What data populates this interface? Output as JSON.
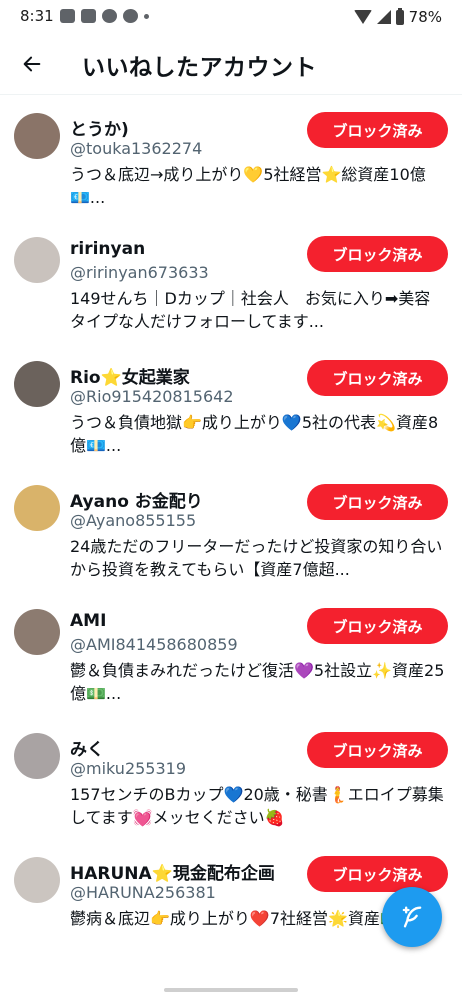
{
  "status_bar": {
    "time": "8:31",
    "battery": "78%"
  },
  "header": {
    "title": "いいねしたアカウント"
  },
  "block_button_label": "ブロック済み",
  "accounts": [
    {
      "name": "とうか)",
      "handle": "@touka1362274",
      "bio": "うつ＆底辺→成り上がり💛5社経営⭐総資産10億💶...",
      "avatar_color": "#8a7468"
    },
    {
      "name": "ririnyan",
      "handle": "@ririnyan673633",
      "bio": "149せんち｜Dカップ｜社会人　お気に入り➡美容　　　タイプな人だけフォローしてます...",
      "avatar_color": "#c9c2bd"
    },
    {
      "name": "Rio⭐女起業家",
      "handle": "@Rio915420815642",
      "bio": "うつ＆負債地獄👉成り上がり💙5社の代表💫資産8億💶...",
      "avatar_color": "#6b625c"
    },
    {
      "name": "Ayano お金配り",
      "handle": "@Ayano855155",
      "bio": "24歳ただのフリーターだったけど投資家の知り合いから投資を教えてもらい【資産7億超...",
      "avatar_color": "#d9b36a"
    },
    {
      "name": "AMI",
      "handle": "@AMI841458680859",
      "bio": "鬱＆負債まみれだったけど復活💜5社設立✨資産25億💵...",
      "avatar_color": "#8c7b70"
    },
    {
      "name": "みく",
      "handle": "@miku255319",
      "bio": "157センチのBカップ💙20歳・秘書🧜エロイプ募集してます💓メッセください🍓",
      "avatar_color": "#a9a3a3"
    },
    {
      "name": "HARUNA⭐現金配布企画",
      "handle": "@HARUNA256381",
      "bio": "鬱病＆底辺👉成り上がり❤️7社経営🌟資産💵...",
      "avatar_color": "#cbc5c0"
    }
  ],
  "icons": {
    "back": "arrow-left-icon",
    "fab": "compose-feather-icon"
  },
  "colors": {
    "block": "#f4212e",
    "accent": "#1d9bf0",
    "secondary_text": "#536471"
  }
}
